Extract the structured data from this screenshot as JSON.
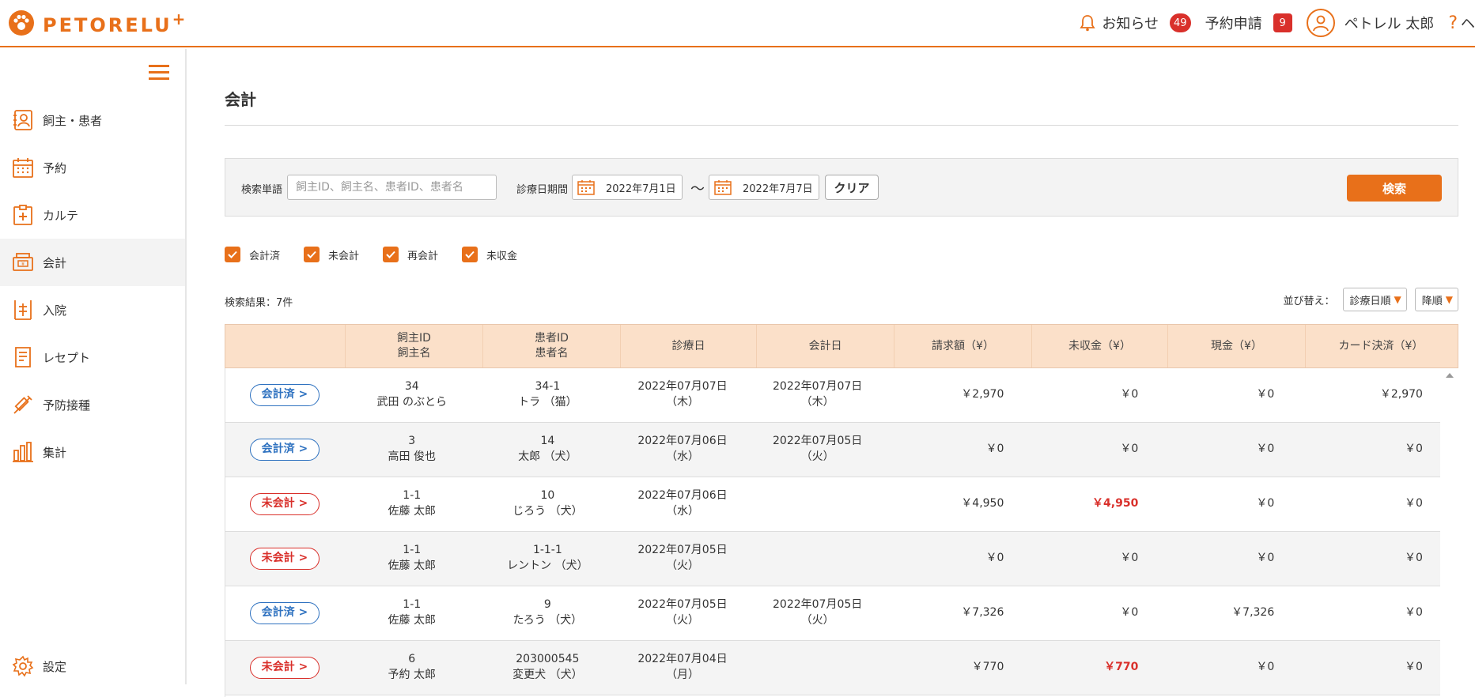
{
  "header": {
    "logo_text": "PETORELU",
    "logo_plus": "+",
    "notifications_label": "お知らせ",
    "notifications_count": "49",
    "requests_label": "予約申請",
    "requests_count": "9",
    "user_name": "ペトレル 太郎",
    "help_label": "?",
    "help_cut_text": "ヘ"
  },
  "sidebar": {
    "items": [
      {
        "label": "飼主・患者",
        "icon": "owner-patient-icon"
      },
      {
        "label": "予約",
        "icon": "calendar-icon"
      },
      {
        "label": "カルテ",
        "icon": "medical-chart-icon"
      },
      {
        "label": "会計",
        "icon": "register-icon"
      },
      {
        "label": "入院",
        "icon": "hospitalization-icon"
      },
      {
        "label": "レセプト",
        "icon": "receipt-icon"
      },
      {
        "label": "予防接種",
        "icon": "syringe-icon"
      },
      {
        "label": "集計",
        "icon": "bar-chart-icon"
      }
    ],
    "settings_label": "設定"
  },
  "page": {
    "title": "会計"
  },
  "search": {
    "keyword_label": "検索単語",
    "keyword_placeholder": "飼主ID、飼主名、患者ID、患者名",
    "date_label": "診療日期間",
    "date_from": "2022年7月1日",
    "date_sep": "～",
    "date_to": "2022年7月7日",
    "clear_label": "クリア",
    "search_label": "検索"
  },
  "filters": [
    {
      "label": "会計済",
      "checked": true
    },
    {
      "label": "未会計",
      "checked": true
    },
    {
      "label": "再会計",
      "checked": true
    },
    {
      "label": "未収金",
      "checked": true
    }
  ],
  "results": {
    "count_text": "検索結果：7件",
    "sort_label": "並び替え：",
    "sort_field": "診療日順",
    "sort_order": "降順"
  },
  "table": {
    "headers": [
      "",
      "飼主ID\n飼主名",
      "患者ID\n患者名",
      "診療日",
      "会計日",
      "請求額（¥）",
      "未収金（¥）",
      "現金（¥）",
      "カード決済（¥）"
    ],
    "rows": [
      {
        "status": "会計済 >",
        "status_type": "done",
        "owner_id": "34",
        "owner_name": "武田 のぶとら",
        "patient_id": "34-1",
        "patient_name": "トラ （猫）",
        "visit_date": "2022年07月07日",
        "visit_dow": "（木）",
        "pay_date": "2022年07月07日",
        "pay_dow": "（木）",
        "billed": "￥2,970",
        "unpaid": "￥0",
        "unpaid_red": false,
        "cash": "￥0",
        "card": "￥2,970"
      },
      {
        "status": "会計済 >",
        "status_type": "done",
        "owner_id": "3",
        "owner_name": "高田 俊也",
        "patient_id": "14",
        "patient_name": "太郎 （犬）",
        "visit_date": "2022年07月06日",
        "visit_dow": "（水）",
        "pay_date": "2022年07月05日",
        "pay_dow": "（火）",
        "billed": "￥0",
        "unpaid": "￥0",
        "unpaid_red": false,
        "cash": "￥0",
        "card": "￥0"
      },
      {
        "status": "未会計 >",
        "status_type": "todo",
        "owner_id": "1-1",
        "owner_name": "佐藤 太郎",
        "patient_id": "10",
        "patient_name": "じろう （犬）",
        "visit_date": "2022年07月06日",
        "visit_dow": "（水）",
        "pay_date": "",
        "pay_dow": "",
        "billed": "￥4,950",
        "unpaid": "￥4,950",
        "unpaid_red": true,
        "cash": "￥0",
        "card": "￥0"
      },
      {
        "status": "未会計 >",
        "status_type": "todo",
        "owner_id": "1-1",
        "owner_name": "佐藤 太郎",
        "patient_id": "1-1-1",
        "patient_name": "レントン （犬）",
        "visit_date": "2022年07月05日",
        "visit_dow": "（火）",
        "pay_date": "",
        "pay_dow": "",
        "billed": "￥0",
        "unpaid": "￥0",
        "unpaid_red": false,
        "cash": "￥0",
        "card": "￥0"
      },
      {
        "status": "会計済 >",
        "status_type": "done",
        "owner_id": "1-1",
        "owner_name": "佐藤 太郎",
        "patient_id": "9",
        "patient_name": "たろう （犬）",
        "visit_date": "2022年07月05日",
        "visit_dow": "（火）",
        "pay_date": "2022年07月05日",
        "pay_dow": "（火）",
        "billed": "￥7,326",
        "unpaid": "￥0",
        "unpaid_red": false,
        "cash": "￥7,326",
        "card": "￥0"
      },
      {
        "status": "未会計 >",
        "status_type": "todo",
        "owner_id": "6",
        "owner_name": "予約 太郎",
        "patient_id": "203000545",
        "patient_name": "変更犬 （犬）",
        "visit_date": "2022年07月04日",
        "visit_dow": "（月）",
        "pay_date": "",
        "pay_dow": "",
        "billed": "￥770",
        "unpaid": "￥770",
        "unpaid_red": true,
        "cash": "￥0",
        "card": "￥0"
      }
    ]
  },
  "colors": {
    "accent": "#e8701a",
    "done": "#2f72c0",
    "todo": "#d9302b",
    "header_bg": "#fbe0c9"
  }
}
